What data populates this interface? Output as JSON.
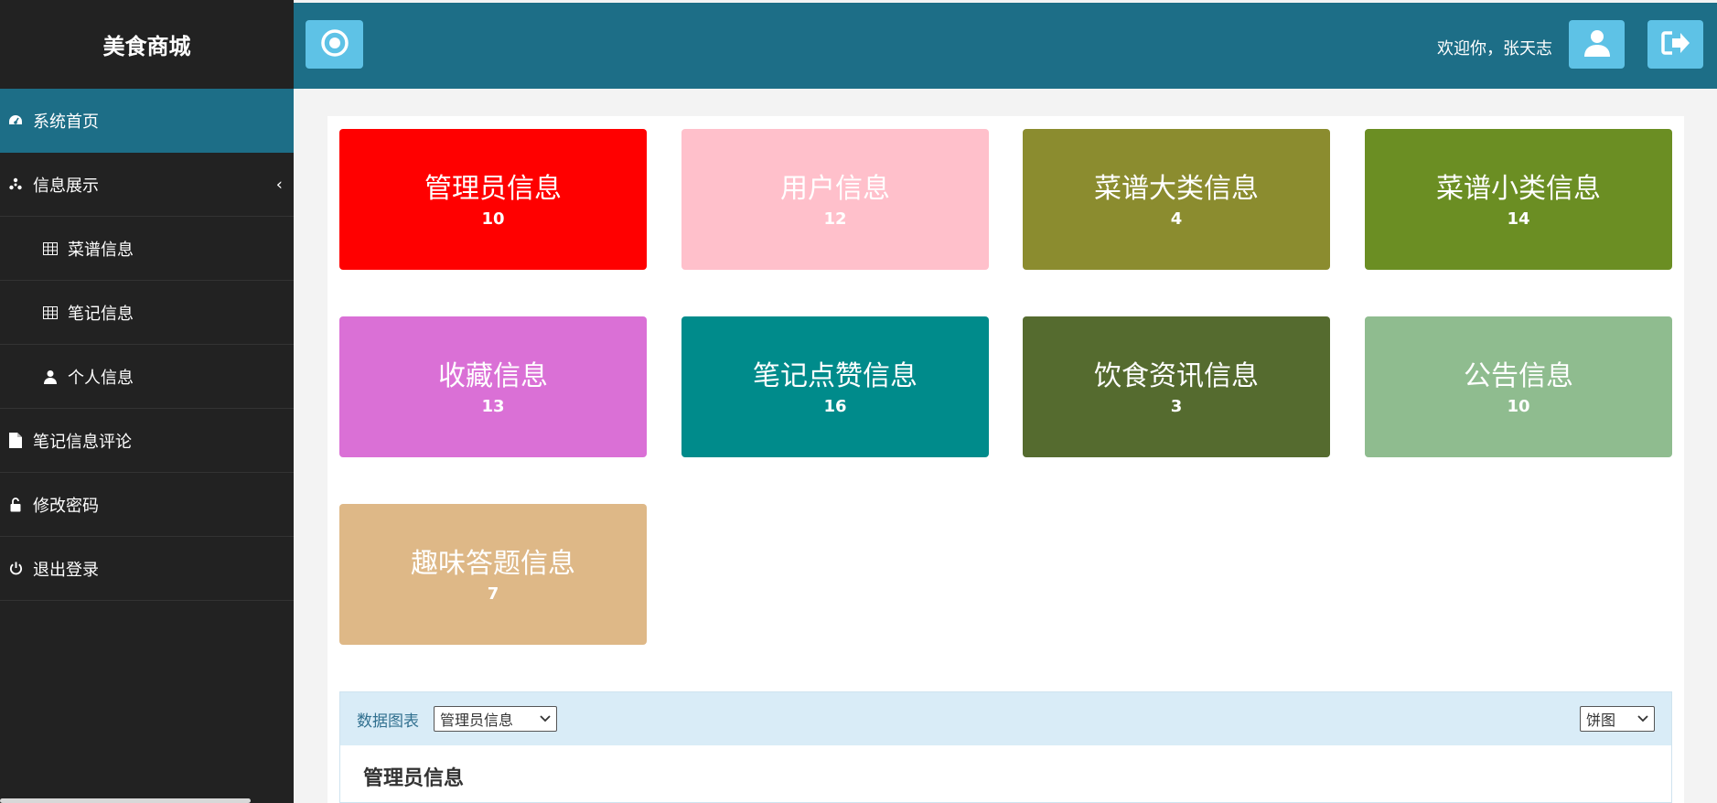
{
  "app": {
    "brand": "美食商城"
  },
  "sidebar": {
    "items": [
      {
        "label": "系统首页",
        "icon": "dashboard-icon",
        "active": true
      },
      {
        "label": "信息展示",
        "icon": "asterisk-icon",
        "expanded": true
      },
      {
        "label": "菜谱信息",
        "icon": "table-icon",
        "sub": true
      },
      {
        "label": "笔记信息",
        "icon": "table-icon",
        "sub": true
      },
      {
        "label": "个人信息",
        "icon": "user-icon",
        "sub": true
      },
      {
        "label": "笔记信息评论",
        "icon": "file-icon"
      },
      {
        "label": "修改密码",
        "icon": "unlock-icon"
      },
      {
        "label": "退出登录",
        "icon": "power-icon"
      }
    ]
  },
  "topbar": {
    "welcome": "欢迎你，张天志"
  },
  "cards": [
    {
      "title": "管理员信息",
      "count": "10",
      "color": "#ff0000"
    },
    {
      "title": "用户信息",
      "count": "12",
      "color": "#ffc0cb"
    },
    {
      "title": "菜谱大类信息",
      "count": "4",
      "color": "#8b8c2f"
    },
    {
      "title": "菜谱小类信息",
      "count": "14",
      "color": "#6b8e23"
    },
    {
      "title": "收藏信息",
      "count": "13",
      "color": "#da70d6"
    },
    {
      "title": "笔记点赞信息",
      "count": "16",
      "color": "#008b8b"
    },
    {
      "title": "饮食资讯信息",
      "count": "3",
      "color": "#556b2f"
    },
    {
      "title": "公告信息",
      "count": "10",
      "color": "#8fbc8f"
    },
    {
      "title": "趣味答题信息",
      "count": "7",
      "color": "#deb887"
    }
  ],
  "chart_panel": {
    "label": "数据图表",
    "data_select": "管理员信息",
    "type_select": "饼图",
    "title": "管理员信息"
  },
  "colors": {
    "sidebar_bg": "#222222",
    "accent": "#1d6e87",
    "button": "#5ec2e6"
  }
}
